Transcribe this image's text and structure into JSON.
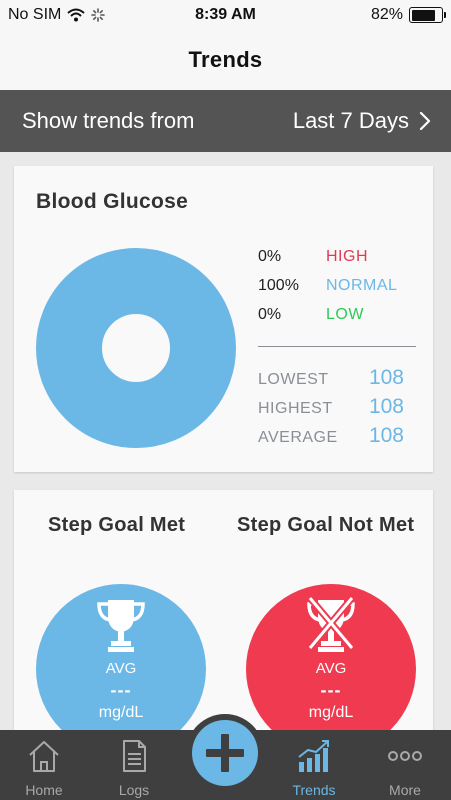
{
  "status": {
    "carrier": "No SIM",
    "time": "8:39 AM",
    "battery": "82%",
    "battery_level": 0.82
  },
  "nav": {
    "title": "Trends"
  },
  "range": {
    "label": "Show trends from",
    "value": "Last 7 Days"
  },
  "glucose": {
    "title": "Blood Glucose",
    "legend": [
      {
        "pct": "0%",
        "name": "HIGH",
        "color": "#e23a52"
      },
      {
        "pct": "100%",
        "name": "NORMAL",
        "color": "#6bb7e6"
      },
      {
        "pct": "0%",
        "name": "LOW",
        "color": "#2fc957"
      }
    ],
    "stats": [
      {
        "label": "LOWEST",
        "value": "108"
      },
      {
        "label": "HIGHEST",
        "value": "108"
      },
      {
        "label": "AVERAGE",
        "value": "108"
      }
    ]
  },
  "steps": {
    "met": {
      "title": "Step Goal Met",
      "avg": "AVG",
      "value": "---",
      "unit": "mg/dL",
      "color": "#6bb7e6",
      "icon": "trophy-icon"
    },
    "not_met": {
      "title": "Step Goal Not Met",
      "avg": "AVG",
      "value": "---",
      "unit": "mg/dL",
      "color": "#ef3a50",
      "icon": "crossed-trophy-icon"
    }
  },
  "tabs": [
    {
      "label": "Home",
      "icon": "home-icon"
    },
    {
      "label": "Logs",
      "icon": "document-icon"
    },
    {
      "label": "Trends",
      "icon": "bar-chart-icon",
      "active": true
    },
    {
      "label": "More",
      "icon": "more-dots-icon"
    }
  ],
  "add_button": {
    "icon": "plus-icon"
  },
  "colors": {
    "accent": "#6bb7e6",
    "high": "#e23a52",
    "low": "#2fc957",
    "bar": "#545454",
    "tabbar": "#3f3f3f"
  }
}
